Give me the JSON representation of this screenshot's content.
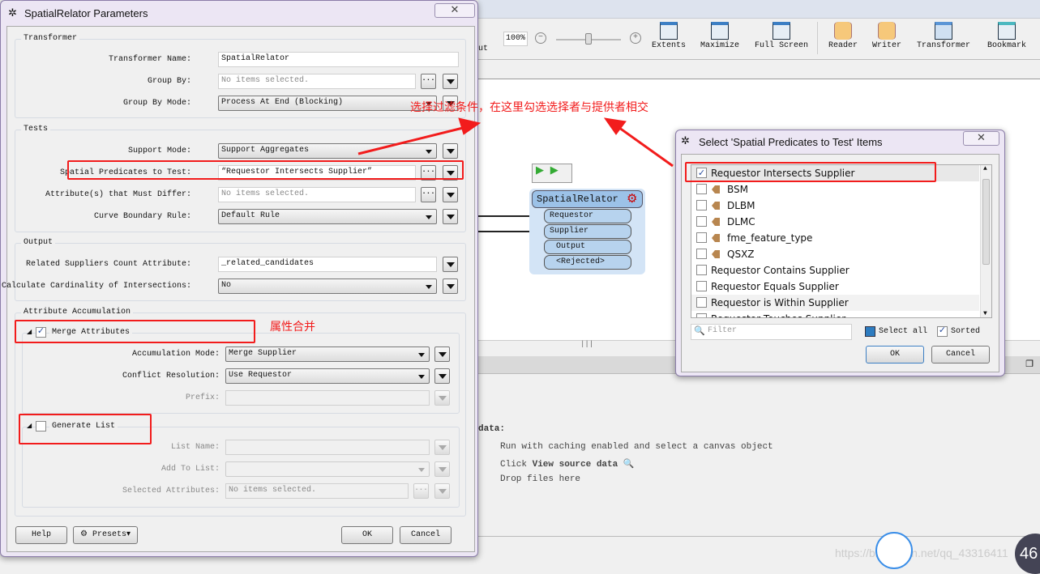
{
  "app": {
    "toolbar": {
      "cut_label": "ut",
      "zoom_value": "100%",
      "zoom_level_fraction": 0.5,
      "buttons": [
        {
          "label": "Extents",
          "icon": "extents-icon"
        },
        {
          "label": "Maximize",
          "icon": "maximize-icon"
        },
        {
          "label": "Full Screen",
          "icon": "full-screen-icon"
        },
        {
          "label": "Reader",
          "icon": "add-reader-icon"
        },
        {
          "label": "Writer",
          "icon": "add-writer-icon"
        },
        {
          "label": "Transformer",
          "icon": "add-transformer-icon"
        },
        {
          "label": "Bookmark",
          "icon": "add-bookmark-icon"
        }
      ]
    },
    "canvas": {
      "transformer": {
        "name": "SpatialRelator",
        "inputs": [
          "Requestor",
          "Supplier"
        ],
        "outputs": [
          "Output",
          "<Rejected>"
        ]
      }
    },
    "inspector": {
      "heading": "data:",
      "lines": [
        "Run with caching enabled and select a canvas object",
        "Click ",
        "View source data",
        "Drop files here"
      ]
    },
    "watermark": "https://blog.csdn.net/qq_43316411",
    "badge_number": "46"
  },
  "params_dialog": {
    "title": "SpatialRelator Parameters",
    "groups": {
      "transformer": "Transformer",
      "tests": "Tests",
      "output": "Output",
      "accumulation": "Attribute Accumulation"
    },
    "fields": {
      "transformer_name": {
        "label": "Transformer Name:",
        "value": "SpatialRelator"
      },
      "group_by": {
        "label": "Group By:",
        "placeholder": "No items selected."
      },
      "group_by_mode": {
        "label": "Group By Mode:",
        "value": "Process At End (Blocking)"
      },
      "support_mode": {
        "label": "Support Mode:",
        "value": "Support Aggregates"
      },
      "spatial_predicates": {
        "label": "Spatial Predicates to Test:",
        "value": "“Requestor Intersects Supplier”"
      },
      "must_differ": {
        "label": "Attribute(s) that Must Differ:",
        "placeholder": "No items selected."
      },
      "curve_rule": {
        "label": "Curve Boundary Rule:",
        "value": "Default Rule"
      },
      "related_count": {
        "label": "Related Suppliers Count Attribute:",
        "value": "_related_candidates"
      },
      "cardinality": {
        "label": "Calculate Cardinality of Intersections:",
        "value": "No"
      },
      "merge_attributes": {
        "label": "Merge Attributes",
        "checked": true
      },
      "accumulation_mode": {
        "label": "Accumulation Mode:",
        "value": "Merge Supplier"
      },
      "conflict_resolution": {
        "label": "Conflict Resolution:",
        "value": "Use Requestor"
      },
      "prefix": {
        "label": "Prefix:",
        "value": ""
      },
      "generate_list": {
        "label": "Generate List",
        "checked": false
      },
      "list_name": {
        "label": "List Name:",
        "value": ""
      },
      "add_to_list": {
        "label": "Add To List:",
        "value": ""
      },
      "selected_attributes": {
        "label": "Selected Attributes:",
        "placeholder": "No items selected."
      }
    },
    "buttons": {
      "help": "Help",
      "presets": "Presets",
      "ok": "OK",
      "cancel": "Cancel"
    }
  },
  "select_dialog": {
    "title": "Select 'Spatial Predicates to Test' Items",
    "items": [
      {
        "label": "Requestor Intersects Supplier",
        "checked": true,
        "attribute": false
      },
      {
        "label": "BSM",
        "checked": false,
        "attribute": true
      },
      {
        "label": "DLBM",
        "checked": false,
        "attribute": true
      },
      {
        "label": "DLMC",
        "checked": false,
        "attribute": true
      },
      {
        "label": "fme_feature_type",
        "checked": false,
        "attribute": true
      },
      {
        "label": "QSXZ",
        "checked": false,
        "attribute": true
      },
      {
        "label": "Requestor Contains Supplier",
        "checked": false,
        "attribute": false
      },
      {
        "label": "Requestor Equals Supplier",
        "checked": false,
        "attribute": false
      },
      {
        "label": "Requestor is Within Supplier",
        "checked": false,
        "attribute": false
      },
      {
        "label": "Requestor Touches Supplier",
        "checked": false,
        "attribute": false
      }
    ],
    "filter_placeholder": "Filter",
    "select_all": {
      "label": "Select all",
      "state": "partial"
    },
    "sorted": {
      "label": "Sorted",
      "checked": true
    },
    "buttons": {
      "ok": "OK",
      "cancel": "Cancel"
    }
  },
  "annotations": {
    "predicate_note": "选择过滤条件，在这里勾选选择者与提供者相交",
    "merge_note": "属性合并",
    "color": "#f21c1c"
  }
}
